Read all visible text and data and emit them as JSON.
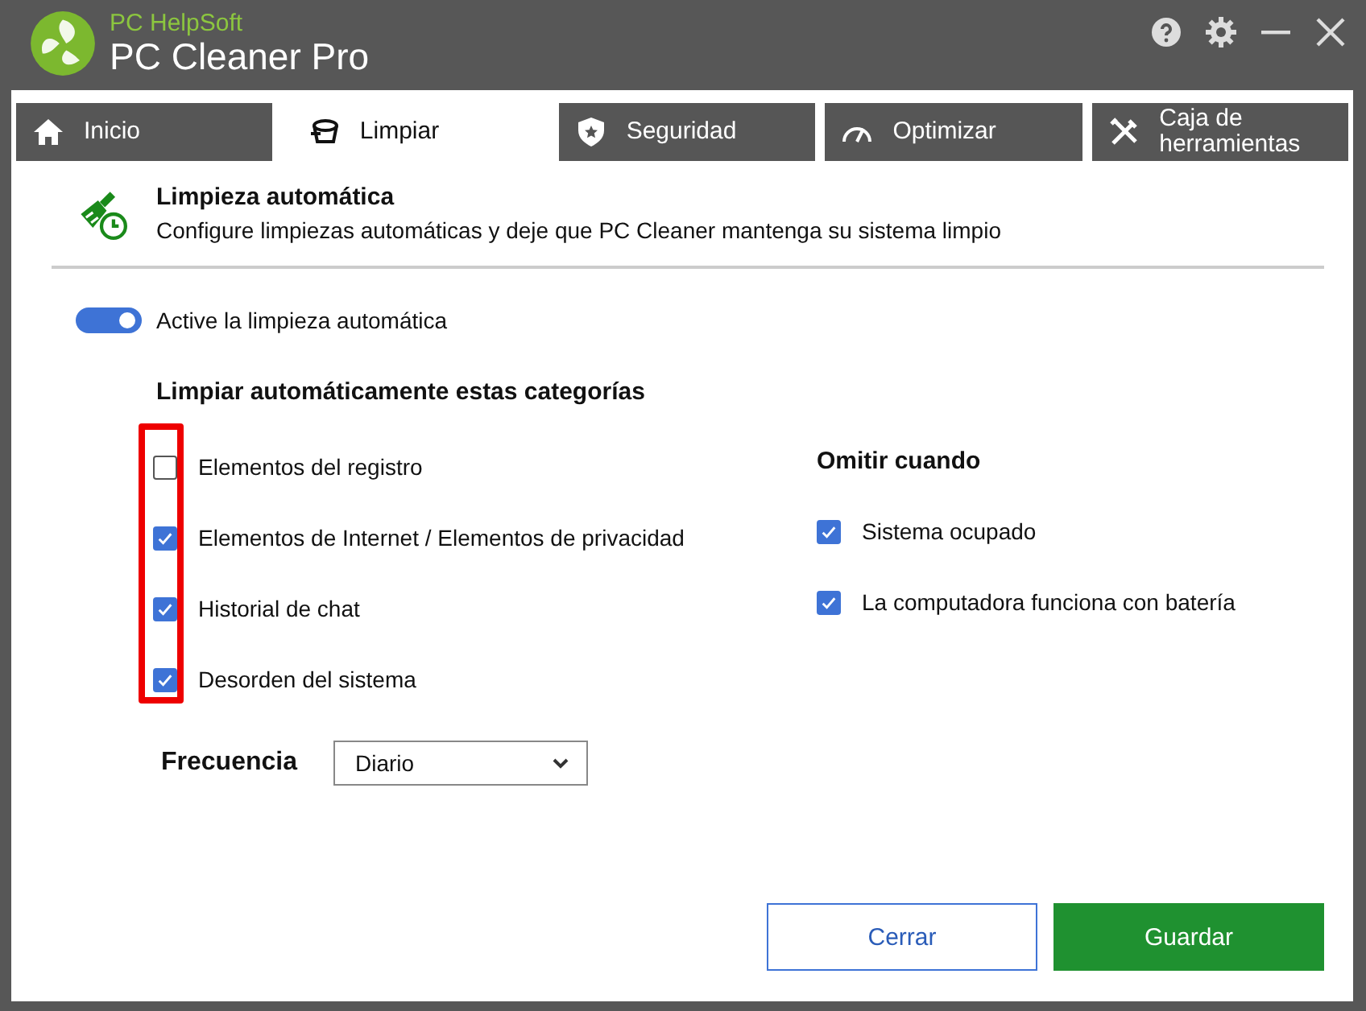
{
  "app": {
    "brand": "PC HelpSoft",
    "title": "PC Cleaner Pro"
  },
  "tabs": [
    {
      "label": "Inicio",
      "selected": false
    },
    {
      "label": "Limpiar",
      "selected": true
    },
    {
      "label": "Seguridad",
      "selected": false
    },
    {
      "label": "Optimizar",
      "selected": false
    },
    {
      "label": "Caja de herramientas",
      "selected": false
    }
  ],
  "section": {
    "title": "Limpieza automática",
    "description": "Configure limpiezas automáticas y deje que PC Cleaner mantenga su sistema limpio"
  },
  "auto_clean": {
    "label": "Active la limpieza automática",
    "on": true
  },
  "categories": {
    "title": "Limpiar automáticamente estas categorías",
    "highlighted": true,
    "items": [
      {
        "label": "Elementos del registro",
        "checked": false
      },
      {
        "label": "Elementos de Internet / Elementos de privacidad",
        "checked": true
      },
      {
        "label": "Historial de chat",
        "checked": true
      },
      {
        "label": "Desorden del sistema",
        "checked": true
      }
    ]
  },
  "skip_when": {
    "title": "Omitir cuando",
    "items": [
      {
        "label": "Sistema ocupado",
        "checked": true
      },
      {
        "label": "La computadora funciona con batería",
        "checked": true
      }
    ]
  },
  "frequency": {
    "label": "Frecuencia",
    "value": "Diario"
  },
  "buttons": [
    {
      "label": "Cerrar",
      "kind": "secondary"
    },
    {
      "label": "Guardar",
      "kind": "primary"
    }
  ]
}
